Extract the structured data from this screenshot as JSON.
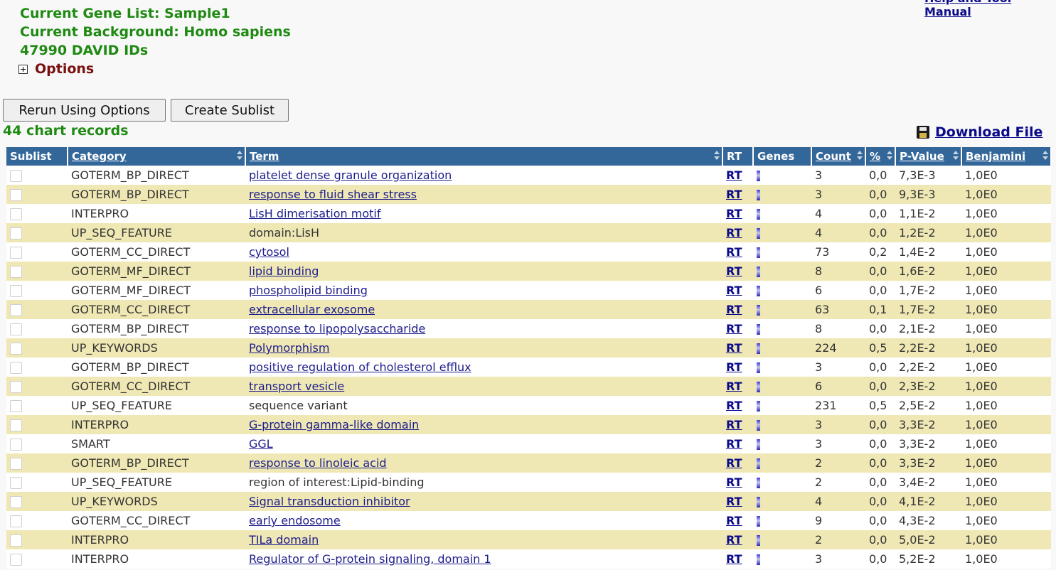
{
  "header": {
    "top_link": "Help and Tool Manual",
    "gene_list": "Current Gene List: Sample1",
    "background": "Current Background: Homo sapiens",
    "david_ids": "47990 DAVID IDs",
    "options_label": "Options"
  },
  "buttons": {
    "rerun": "Rerun Using Options",
    "sublist": "Create Sublist"
  },
  "records_count": "44 chart records",
  "download_label": "Download File",
  "columns": [
    "Sublist",
    "Category",
    "Term",
    "RT",
    "Genes",
    "Count",
    "%",
    "P-Value",
    "Benjamini"
  ],
  "rows": [
    {
      "category": "GOTERM_BP_DIRECT",
      "term": "platelet dense granule organization",
      "linked": true,
      "rt": "RT",
      "count": "3",
      "pct": "0,0",
      "pvalue": "7,3E-3",
      "benjamini": "1,0E0"
    },
    {
      "category": "GOTERM_BP_DIRECT",
      "term": "response to fluid shear stress",
      "linked": true,
      "rt": "RT",
      "count": "3",
      "pct": "0,0",
      "pvalue": "9,3E-3",
      "benjamini": "1,0E0"
    },
    {
      "category": "INTERPRO",
      "term": "LisH dimerisation motif",
      "linked": true,
      "rt": "RT",
      "count": "4",
      "pct": "0,0",
      "pvalue": "1,1E-2",
      "benjamini": "1,0E0"
    },
    {
      "category": "UP_SEQ_FEATURE",
      "term": "domain:LisH",
      "linked": false,
      "rt": "RT",
      "count": "4",
      "pct": "0,0",
      "pvalue": "1,2E-2",
      "benjamini": "1,0E0"
    },
    {
      "category": "GOTERM_CC_DIRECT",
      "term": "cytosol",
      "linked": true,
      "rt": "RT",
      "count": "73",
      "pct": "0,2",
      "pvalue": "1,4E-2",
      "benjamini": "1,0E0"
    },
    {
      "category": "GOTERM_MF_DIRECT",
      "term": "lipid binding",
      "linked": true,
      "rt": "RT",
      "count": "8",
      "pct": "0,0",
      "pvalue": "1,6E-2",
      "benjamini": "1,0E0"
    },
    {
      "category": "GOTERM_MF_DIRECT",
      "term": "phospholipid binding",
      "linked": true,
      "rt": "RT",
      "count": "6",
      "pct": "0,0",
      "pvalue": "1,7E-2",
      "benjamini": "1,0E0"
    },
    {
      "category": "GOTERM_CC_DIRECT",
      "term": "extracellular exosome",
      "linked": true,
      "rt": "RT",
      "count": "63",
      "pct": "0,1",
      "pvalue": "1,7E-2",
      "benjamini": "1,0E0"
    },
    {
      "category": "GOTERM_BP_DIRECT",
      "term": "response to lipopolysaccharide",
      "linked": true,
      "rt": "RT",
      "count": "8",
      "pct": "0,0",
      "pvalue": "2,1E-2",
      "benjamini": "1,0E0"
    },
    {
      "category": "UP_KEYWORDS",
      "term": "Polymorphism",
      "linked": true,
      "rt": "RT",
      "count": "224",
      "pct": "0,5",
      "pvalue": "2,2E-2",
      "benjamini": "1,0E0"
    },
    {
      "category": "GOTERM_BP_DIRECT",
      "term": "positive regulation of cholesterol efflux",
      "linked": true,
      "rt": "RT",
      "count": "3",
      "pct": "0,0",
      "pvalue": "2,2E-2",
      "benjamini": "1,0E0"
    },
    {
      "category": "GOTERM_CC_DIRECT",
      "term": "transport vesicle",
      "linked": true,
      "rt": "RT",
      "count": "6",
      "pct": "0,0",
      "pvalue": "2,3E-2",
      "benjamini": "1,0E0"
    },
    {
      "category": "UP_SEQ_FEATURE",
      "term": "sequence variant",
      "linked": false,
      "rt": "RT",
      "count": "231",
      "pct": "0,5",
      "pvalue": "2,5E-2",
      "benjamini": "1,0E0"
    },
    {
      "category": "INTERPRO",
      "term": "G-protein gamma-like domain",
      "linked": true,
      "rt": "RT",
      "count": "3",
      "pct": "0,0",
      "pvalue": "3,3E-2",
      "benjamini": "1,0E0"
    },
    {
      "category": "SMART",
      "term": "GGL",
      "linked": true,
      "rt": "RT",
      "count": "3",
      "pct": "0,0",
      "pvalue": "3,3E-2",
      "benjamini": "1,0E0"
    },
    {
      "category": "GOTERM_BP_DIRECT",
      "term": "response to linoleic acid",
      "linked": true,
      "rt": "RT",
      "count": "2",
      "pct": "0,0",
      "pvalue": "3,3E-2",
      "benjamini": "1,0E0"
    },
    {
      "category": "UP_SEQ_FEATURE",
      "term": "region of interest:Lipid-binding",
      "linked": false,
      "rt": "RT",
      "count": "2",
      "pct": "0,0",
      "pvalue": "3,4E-2",
      "benjamini": "1,0E0"
    },
    {
      "category": "UP_KEYWORDS",
      "term": "Signal transduction inhibitor",
      "linked": true,
      "rt": "RT",
      "count": "4",
      "pct": "0,0",
      "pvalue": "4,1E-2",
      "benjamini": "1,0E0"
    },
    {
      "category": "GOTERM_CC_DIRECT",
      "term": "early endosome",
      "linked": true,
      "rt": "RT",
      "count": "9",
      "pct": "0,0",
      "pvalue": "4,3E-2",
      "benjamini": "1,0E0"
    },
    {
      "category": "INTERPRO",
      "term": "TILa domain",
      "linked": true,
      "rt": "RT",
      "count": "2",
      "pct": "0,0",
      "pvalue": "5,0E-2",
      "benjamini": "1,0E0"
    },
    {
      "category": "INTERPRO",
      "term": "Regulator of G-protein signaling, domain 1",
      "linked": true,
      "rt": "RT",
      "count": "3",
      "pct": "0,0",
      "pvalue": "5,2E-2",
      "benjamini": "1,0E0"
    }
  ]
}
